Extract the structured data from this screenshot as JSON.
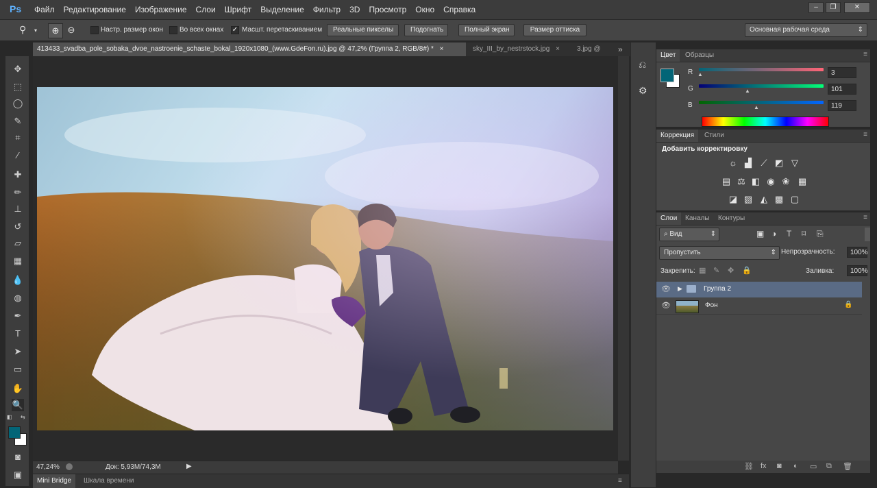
{
  "app": {
    "logo": "Ps"
  },
  "menu": [
    "Файл",
    "Редактирование",
    "Изображение",
    "Слои",
    "Шрифт",
    "Выделение",
    "Фильтр",
    "3D",
    "Просмотр",
    "Окно",
    "Справка"
  ],
  "window_controls": {
    "minimize": "–",
    "restore": "❐",
    "close": "✕"
  },
  "options": {
    "resize_windows": "Настр. размер окон",
    "all_windows": "Во всех окнах",
    "scrubby_zoom": "Масшт. перетаскиванием",
    "scrubby_zoom_checked": true,
    "actual_pixels": "Реальные пикселы",
    "fit_screen": "Подогнать",
    "fill_screen": "Полный экран",
    "print_size": "Размер оттиска",
    "workspace": "Основная рабочая среда"
  },
  "tabs": [
    {
      "label": "413433_svadba_pole_sobaka_dvoe_nastroenie_schaste_bokal_1920x1080_(www.GdeFon.ru).jpg @ 47,2% (Группа 2, RGB/8#) *",
      "close": "×"
    },
    {
      "label": "sky_III_by_nestrstock.jpg",
      "close": "×"
    },
    {
      "label": "3.jpg @"
    }
  ],
  "tabs_overflow": "»",
  "status": {
    "zoom": "47,24%",
    "doc": "Док: 5,93M/74,3M"
  },
  "bottom_tabs": [
    "Mini Bridge",
    "Шкала времени"
  ],
  "color_panel": {
    "tabs": [
      "Цвет",
      "Образцы"
    ],
    "channels": [
      {
        "label": "R",
        "value": "3"
      },
      {
        "label": "G",
        "value": "101"
      },
      {
        "label": "B",
        "value": "119"
      }
    ],
    "foreground": "#036577",
    "background": "#ffffff"
  },
  "adjustments_panel": {
    "tabs": [
      "Коррекция",
      "Стили"
    ],
    "title": "Добавить корректировку"
  },
  "layers_panel": {
    "tabs": [
      "Слои",
      "Каналы",
      "Контуры"
    ],
    "filter_kind": "Вид",
    "blend_mode": "Пропустить",
    "opacity_label": "Непрозрачность:",
    "opacity_value": "100%",
    "lock_label": "Закрепить:",
    "fill_label": "Заливка:",
    "fill_value": "100%",
    "layers": [
      {
        "name": "Группа 2",
        "type": "group",
        "selected": true
      },
      {
        "name": "Фон",
        "type": "background",
        "locked": true
      }
    ]
  }
}
